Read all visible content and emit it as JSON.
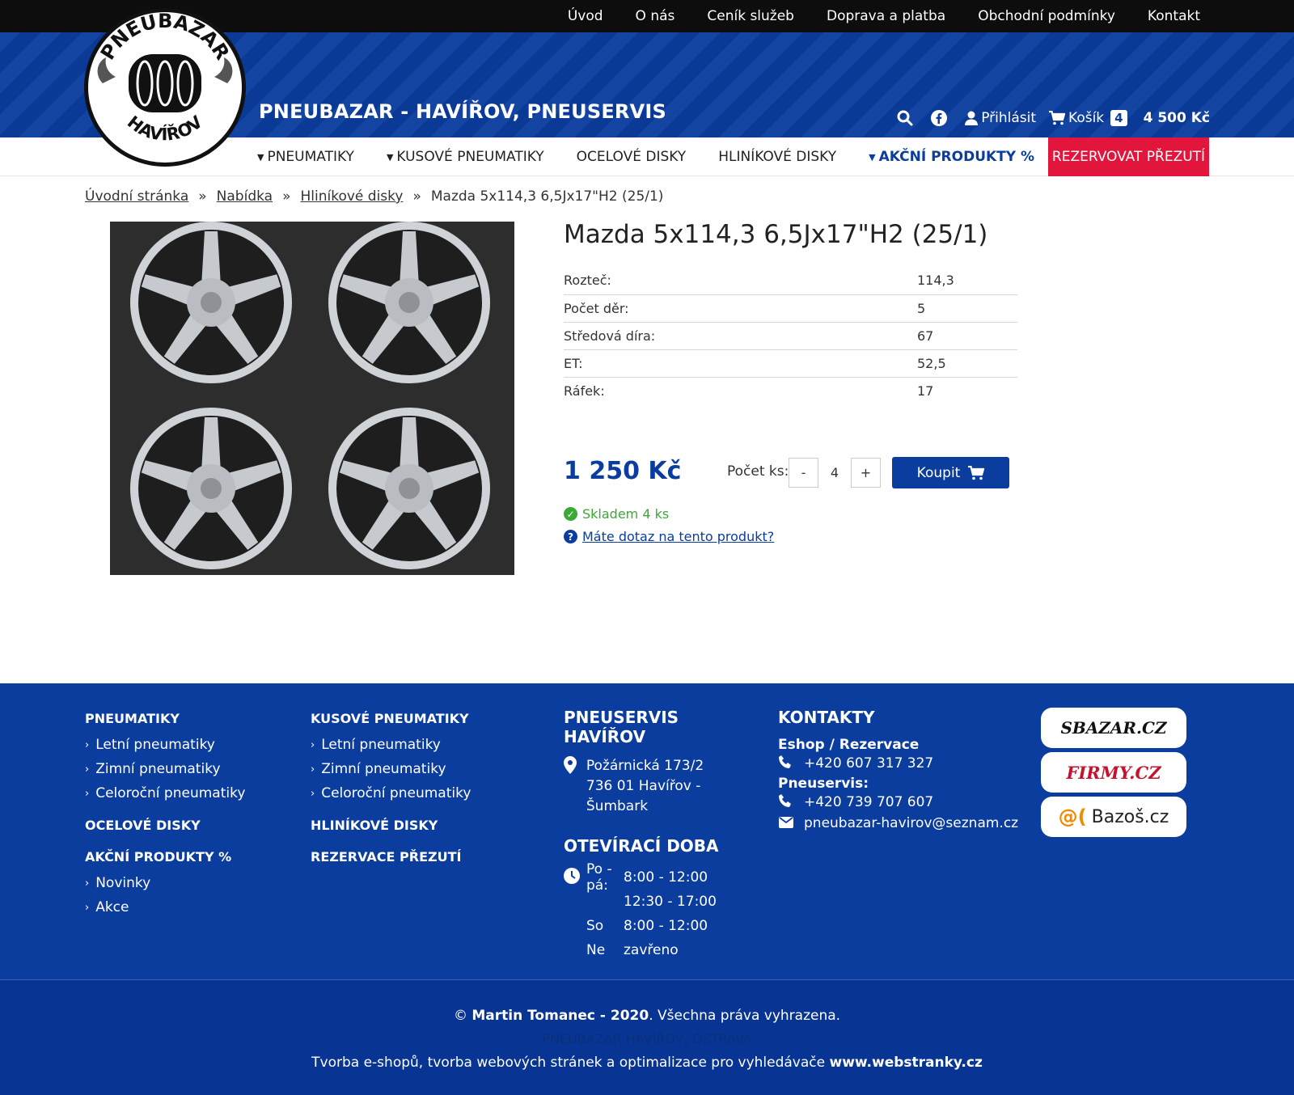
{
  "topnav": [
    "Úvod",
    "O nás",
    "Ceník služeb",
    "Doprava a platba",
    "Obchodní podmínky",
    "Kontakt"
  ],
  "header": {
    "logo_top": "PNEUBAZAR",
    "logo_bottom": "HAVÍŘOV",
    "site_title": "PNEUBAZAR - HAVÍŘOV, PNEUSERVIS",
    "login": "Přihlásit",
    "cart": "Košík",
    "cart_count": "4",
    "cart_total": "4 500 Kč"
  },
  "mainnav": {
    "items": [
      "PNEUMATIKY",
      "KUSOVÉ PNEUMATIKY",
      "OCELOVÉ DISKY",
      "HLINÍKOVÉ DISKY",
      "AKČNÍ PRODUKTY %"
    ],
    "reserve": "REZERVOVAT PŘEZUTÍ"
  },
  "breadcrumb": [
    "Úvodní stránka",
    "Nabídka",
    "Hliníkové disky",
    "Mazda 5x114,3 6,5Jx17\"H2 (25/1)"
  ],
  "product": {
    "title": "Mazda 5x114,3 6,5Jx17\"H2 (25/1)",
    "specs": [
      {
        "label": "Rozteč:",
        "value": "114,3"
      },
      {
        "label": "Počet děr:",
        "value": "5"
      },
      {
        "label": "Středová díra:",
        "value": "67"
      },
      {
        "label": "ET:",
        "value": "52,5"
      },
      {
        "label": "Ráfek:",
        "value": "17"
      }
    ],
    "price": "1 250 Kč",
    "qty_label": "Počet ks:",
    "qty": "4",
    "minus": "-",
    "plus": "+",
    "buy": "Koupit",
    "stock": "Skladem 4 ks",
    "question": "Máte dotaz na tento produkt?"
  },
  "footer": {
    "col1": {
      "head1": "PNEUMATIKY",
      "links1": [
        "Letní pneumatiky",
        "Zimní pneumatiky",
        "Celoroční pneumatiky"
      ],
      "head2": "OCELOVÉ DISKY",
      "head3": "AKČNÍ PRODUKTY %",
      "links3": [
        "Novinky",
        "Akce"
      ]
    },
    "col2": {
      "head1": "KUSOVÉ PNEUMATIKY",
      "links1": [
        "Letní pneumatiky",
        "Zimní pneumatiky",
        "Celoroční pneumatiky"
      ],
      "head2": "HLINÍKOVÉ DISKY",
      "head3": "REZERVACE PŘEZUTÍ"
    },
    "service": {
      "title": "PNEUSERVIS HAVÍŘOV",
      "address1": "Požárnická 173/2",
      "address2": "736 01 Havířov - Šumbark",
      "hours_title": "OTEVÍRACÍ DOBA",
      "hours": [
        {
          "day": "Po - pá:",
          "time": "8:00 - 12:00"
        },
        {
          "day": "",
          "time": "12:30 - 17:00"
        },
        {
          "day": "So",
          "time": "8:00 - 12:00"
        },
        {
          "day": "Ne",
          "time": "zavřeno"
        }
      ]
    },
    "contacts": {
      "title": "KONTAKTY",
      "eshop_label": "Eshop / Rezervace",
      "eshop_phone": "+420 607 317 327",
      "service_label": "Pneuservis:",
      "service_phone": "+420 739 707 607",
      "email": "pneubazar-havirov@seznam.cz"
    },
    "badges": [
      "SBAZAR.CZ",
      "FIRMY.CZ",
      "Bazoš.cz"
    ],
    "copyright_pre": "© ",
    "copyright_name": "Martin Tomanec - 2020",
    "copyright_post": ". Všechna práva vyhrazena.",
    "hidden_line": "PNEUBAZAR HAVÍŘOV, OSTRAVA",
    "credit_pre": "Tvorba e-shopů, tvorba webových stránek a optimalizace pro vyhledávače ",
    "credit_link": "www.webstranky.cz"
  },
  "colors": {
    "brand": "#0a3d9e",
    "accent": "#e2163c",
    "stock": "#3aaa35"
  }
}
